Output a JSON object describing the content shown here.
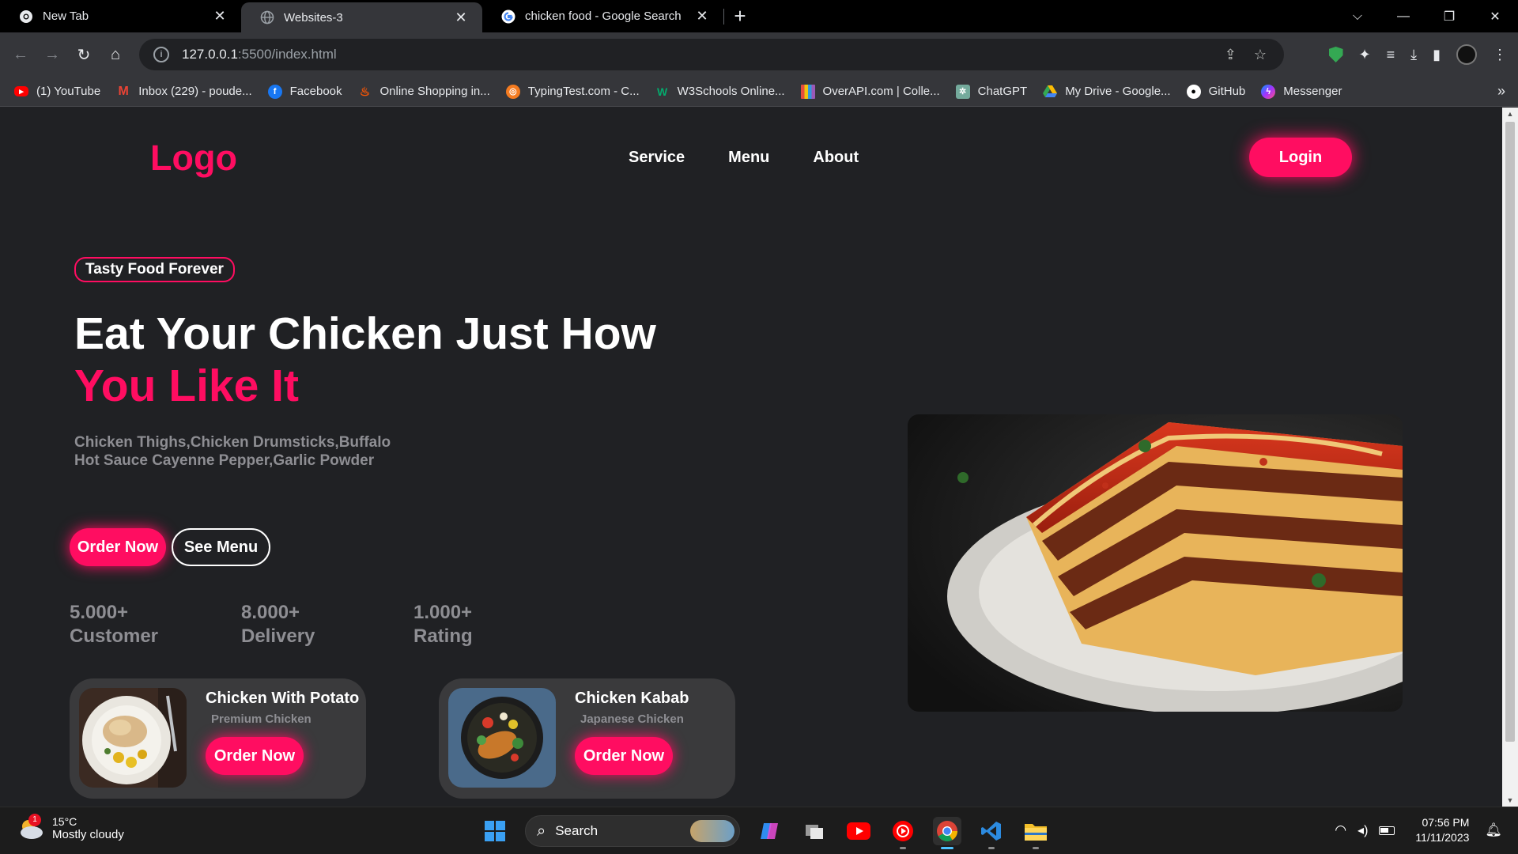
{
  "browser": {
    "tabs": [
      {
        "title": "New Tab",
        "active": false
      },
      {
        "title": "Websites-3",
        "active": true
      },
      {
        "title": "chicken food - Google Search",
        "active": false
      }
    ],
    "url_host": "127.0.0.1",
    "url_path": ":5500/index.html",
    "bookmarks": [
      {
        "label": "(1) YouTube",
        "icon": "youtube-icon",
        "color": "#ff0000"
      },
      {
        "label": "Inbox (229) - poude...",
        "icon": "gmail-icon",
        "color": "#ea4335"
      },
      {
        "label": "Facebook",
        "icon": "facebook-icon",
        "color": "#1877f2"
      },
      {
        "label": "Online Shopping in...",
        "icon": "daraz-icon",
        "color": "#f85606"
      },
      {
        "label": "TypingTest.com - C...",
        "icon": "typingtest-icon",
        "color": "#f47b20"
      },
      {
        "label": "W3Schools Online...",
        "icon": "w3schools-icon",
        "color": "#04aa6d"
      },
      {
        "label": "OverAPI.com | Colle...",
        "icon": "overapi-icon",
        "color": "#e74c3c"
      },
      {
        "label": "ChatGPT",
        "icon": "chatgpt-icon",
        "color": "#74aa9c"
      },
      {
        "label": "My Drive - Google...",
        "icon": "google-drive-icon",
        "color": "#fbbc04"
      },
      {
        "label": "GitHub",
        "icon": "github-icon",
        "color": "#ffffff"
      },
      {
        "label": "Messenger",
        "icon": "messenger-icon",
        "color": "#a033ff"
      }
    ]
  },
  "site": {
    "logo": "Logo",
    "nav": [
      "Service",
      "Menu",
      "About"
    ],
    "login_label": "Login",
    "badge": "Tasty Food Forever",
    "headline_line1": "Eat Your Chicken Just How",
    "headline_line2": "You Like It",
    "description": "Chicken Thighs,Chicken Drumsticks,Buffalo Hot Sauce Cayenne Pepper,Garlic Powder",
    "order_now_label": "Order Now",
    "see_menu_label": "See Menu",
    "stats": [
      {
        "value": "5.000+",
        "label": "Customer"
      },
      {
        "value": "8.000+",
        "label": "Delivery"
      },
      {
        "value": "1.000+",
        "label": "Rating"
      }
    ],
    "cards": [
      {
        "name": "Chicken With Potato",
        "subtitle": "Premium Chicken",
        "button": "Order Now"
      },
      {
        "name": "Chicken Kabab",
        "subtitle": "Japanese Chicken",
        "button": "Order Now"
      }
    ],
    "accent_color": "#ff0d61"
  },
  "taskbar": {
    "weather_temp": "15°C",
    "weather_desc": "Mostly cloudy",
    "weather_badge": "1",
    "search_label": "Search",
    "time": "07:56 PM",
    "date": "11/11/2023"
  }
}
